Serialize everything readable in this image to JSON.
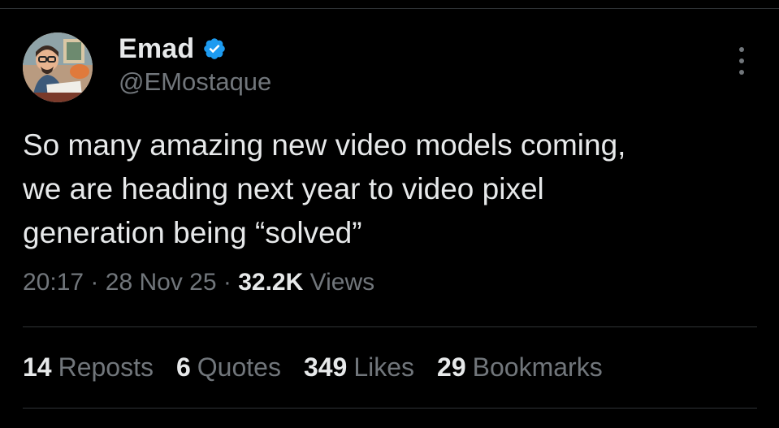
{
  "author": {
    "display_name": "Emad",
    "handle": "@EMostaque",
    "verified": true,
    "verified_color": "#1d9bf0"
  },
  "tweet": {
    "lines": [
      "So many amazing new video models coming,",
      "we are heading next year to video pixel",
      "generation being “solved”"
    ]
  },
  "meta": {
    "time": "20:17",
    "dot": "·",
    "date": "28 Nov 25",
    "views_count": "32.2K",
    "views_label": "Views"
  },
  "stats": {
    "reposts_count": "14",
    "reposts_label": "Reposts",
    "quotes_count": "6",
    "quotes_label": "Quotes",
    "likes_count": "349",
    "likes_label": "Likes",
    "bookmarks_count": "29",
    "bookmarks_label": "Bookmarks"
  },
  "icons": {
    "more": "more-options-icon",
    "verified": "verified-badge-icon"
  },
  "colors": {
    "background": "#000000",
    "text": "#e7e9ea",
    "muted": "#71767b",
    "divider": "#2f3336"
  }
}
